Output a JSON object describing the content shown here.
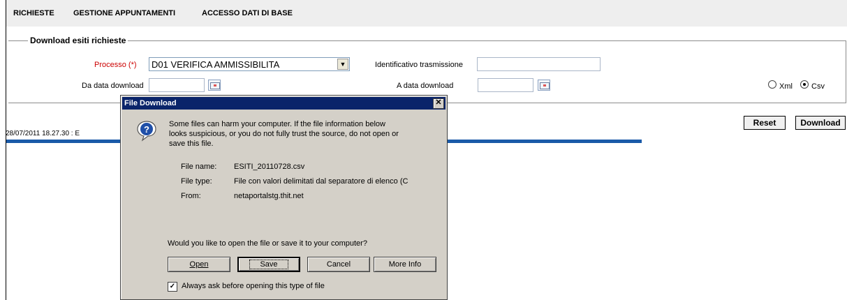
{
  "menu": {
    "items": [
      "RICHIESTE",
      "GESTIONE APPUNTAMENTI",
      "ACCESSO DATI DI BASE"
    ]
  },
  "form": {
    "legend": "Download esiti richieste",
    "processo_label": "Processo (*)",
    "processo_value": "D01 VERIFICA AMMISSIBILITA",
    "identificativo_label": "Identificativo trasmissione",
    "identificativo_value": "",
    "da_data_label": "Da data download",
    "da_data_value": "",
    "a_data_label": "A data download",
    "a_data_value": "",
    "format_options": [
      "Xml",
      "Csv"
    ],
    "format_selected": "Csv"
  },
  "actions": {
    "reset_label": "Reset",
    "download_label": "Download"
  },
  "status": {
    "timestamp": "28/07/2011 18.27.30  :  E"
  },
  "dialog": {
    "title": "File Download",
    "warning_line1": "Some files can harm your computer. If the file information below",
    "warning_line2": "looks suspicious, or you do not fully trust the source, do not open or",
    "warning_line3": "save this file.",
    "file_name_label": "File name:",
    "file_name_value": "ESITI_20110728.csv",
    "file_type_label": "File type:",
    "file_type_value": "File con valori delimitati dal separatore di elenco (C",
    "from_label": "From:",
    "from_value": "netaportalstg.thit.net",
    "question": "Would you like to open the file or save it to your computer?",
    "open_label": "Open",
    "save_label": "Save",
    "cancel_label": "Cancel",
    "more_info_label": "More Info",
    "always_ask_label": "Always ask before opening this type of file",
    "always_ask_checked": true
  },
  "colors": {
    "required": "#cc0000",
    "titlebar": "#0a246a",
    "dialog_bg": "#d4d0c8",
    "rule": "#1a5aa8"
  }
}
